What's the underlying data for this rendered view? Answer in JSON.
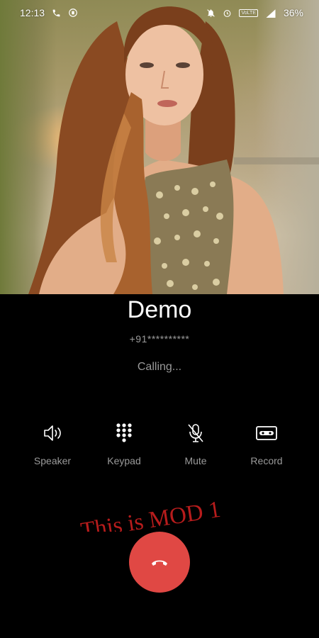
{
  "status_bar": {
    "time": "12:13",
    "battery": "36%",
    "volte": "VoLTE"
  },
  "caller": {
    "name": "Demo",
    "number": "+91**********",
    "status": "Calling..."
  },
  "controls": [
    {
      "label": "Speaker",
      "icon": "speaker-icon"
    },
    {
      "label": "Keypad",
      "icon": "keypad-icon"
    },
    {
      "label": "Mute",
      "icon": "mic-off-icon"
    },
    {
      "label": "Record",
      "icon": "record-icon"
    }
  ],
  "overlay_text": "This is MOD 1",
  "colors": {
    "end_call": "#e04844",
    "overlay_text": "#b71c1c",
    "secondary_text": "#9a9a9a"
  }
}
